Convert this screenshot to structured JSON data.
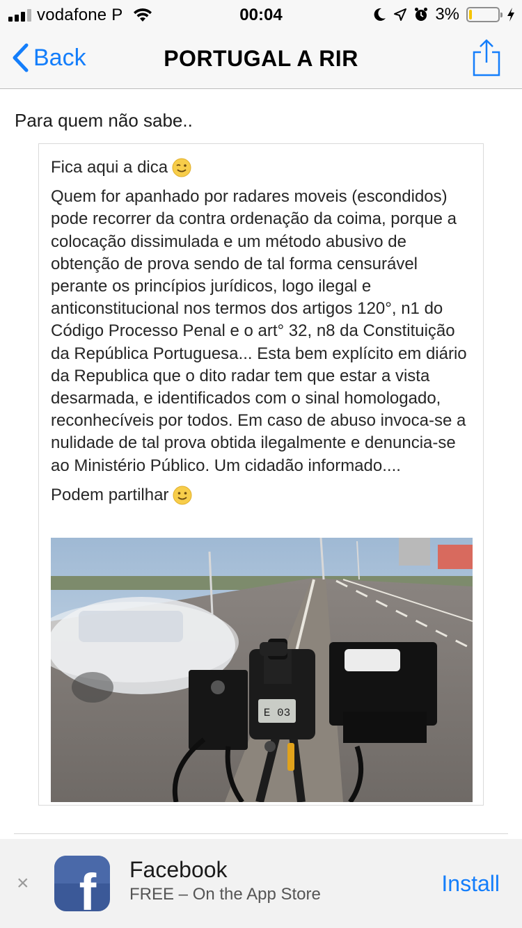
{
  "status_bar": {
    "carrier": "vodafone P",
    "time": "00:04",
    "battery_percent": "3%",
    "battery_level": 0.03,
    "icons": [
      "signal-icon",
      "wifi-icon",
      "moon-icon",
      "location-icon",
      "alarm-icon",
      "battery-icon",
      "charging-icon"
    ]
  },
  "nav": {
    "back_label": "Back",
    "title": "PORTUGAL A RIR",
    "share_icon": "share-icon"
  },
  "post": {
    "caption": "Para quem não sabe..",
    "intro": "Fica aqui a dica",
    "body": "Quem for apanhado por radares moveis (escondidos) pode recorrer da contra ordenação da coima, porque a colocação dissimulada e um método abusivo de obtenção de prova sendo de tal forma censurável perante os princípios jurídicos, logo ilegal e anticonstitucional nos termos dos artigos 120°, n1 do Código Processo Penal e o art° 32, n8 da Constituição da República Portuguesa... Esta bem explícito em diário da Republica que o dito radar tem que estar a vista desarmada, e identificados com o sinal homologado, reconhecíveis por todos. Em caso de abuso invoca-se a nulidade de tal prova obtida ilegalmente e denuncia-se ao Ministério Público. Um cidadão informado....",
    "outro": "Podem partilhar",
    "photo_display_text": "E 03"
  },
  "app_banner": {
    "app_name": "Facebook",
    "subtitle": "FREE – On the App Store",
    "install_label": "Install",
    "close_label": "×",
    "icon_letter": "f"
  },
  "colors": {
    "accent": "#147efb",
    "battery_low": "#f5c400",
    "facebook_blue": "#3b5998"
  }
}
